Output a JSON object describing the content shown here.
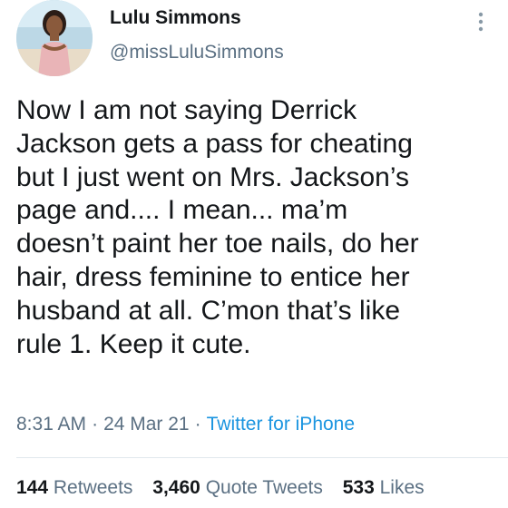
{
  "user": {
    "display_name": "Lulu Simmons",
    "handle": "@missLuluSimmons",
    "avatar_icon": "profile-photo"
  },
  "tweet": {
    "text": "Now I am not saying Derrick\nJackson gets a pass for cheating\nbut I just went on Mrs. Jackson’s\npage and.... I mean... ma’m\ndoesn’t paint her toe nails, do her\nhair, dress feminine to entice her\nhusband at all. C’mon that’s like\nrule 1. Keep it cute.",
    "time": "8:31 AM",
    "date": "24 Mar 21",
    "source": "Twitter for iPhone",
    "separator": "·"
  },
  "stats": {
    "retweets": {
      "count": "144",
      "label": "Retweets"
    },
    "quotes": {
      "count": "3,460",
      "label": "Quote Tweets"
    },
    "likes": {
      "count": "533",
      "label": "Likes"
    }
  },
  "colors": {
    "text": "#14171a",
    "secondary": "#5b7083",
    "link": "#1b95e0",
    "divider": "#e1e8ed"
  }
}
